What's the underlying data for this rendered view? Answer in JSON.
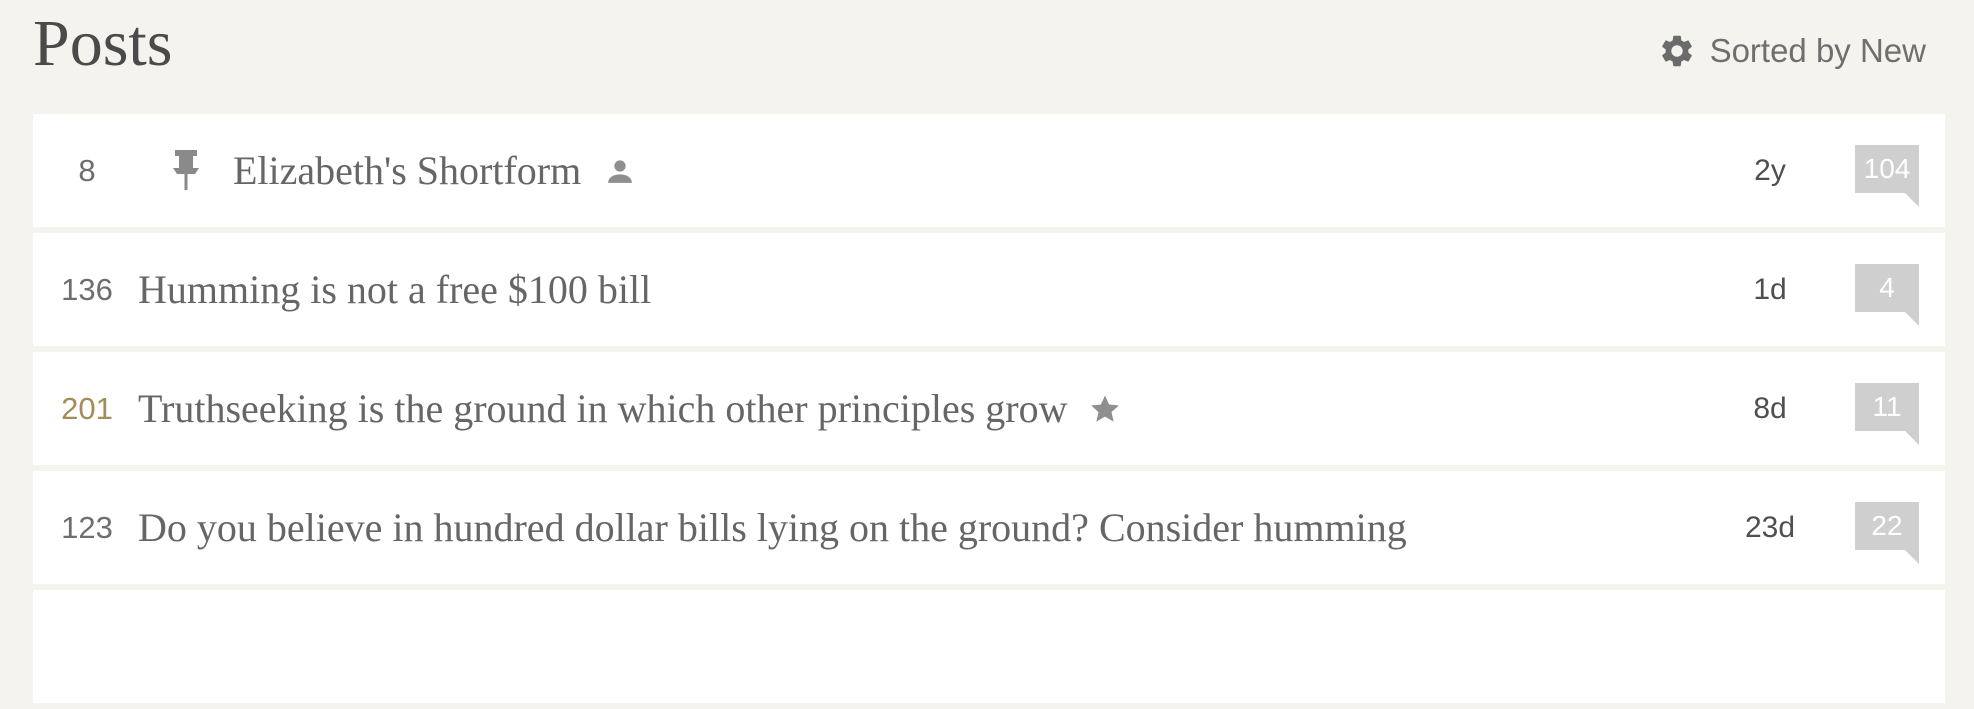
{
  "header": {
    "title": "Posts",
    "sort_label": "Sorted by New"
  },
  "posts": [
    {
      "score": "8",
      "title": "Elizabeth's Shortform",
      "age": "2y",
      "comments": "104",
      "pinned": true,
      "shortform": true,
      "curated": false
    },
    {
      "score": "136",
      "title": "Humming is not a free $100 bill",
      "age": "1d",
      "comments": "4",
      "pinned": false,
      "shortform": false,
      "curated": false
    },
    {
      "score": "201",
      "title": "Truthseeking is the ground in which other principles grow",
      "age": "8d",
      "comments": "11",
      "pinned": false,
      "shortform": false,
      "curated": true
    },
    {
      "score": "123",
      "title": "Do you believe in hundred dollar bills lying on the ground? Consider humming",
      "age": "23d",
      "comments": "22",
      "pinned": false,
      "shortform": false,
      "curated": false
    }
  ],
  "colors": {
    "background": "#f5f3ee",
    "row_background": "#ffffff",
    "highlight_score": "#a58c57",
    "comment_badge": "#cfcfcf"
  },
  "icons": {
    "sort": "gear-icon",
    "pinned": "pin-icon",
    "shortform": "person-icon",
    "curated": "star-icon"
  }
}
